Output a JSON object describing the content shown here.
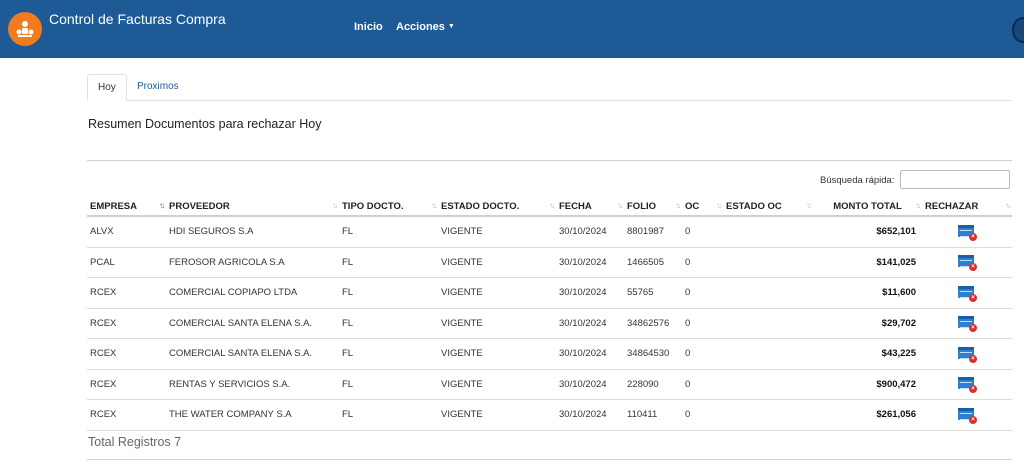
{
  "navbar": {
    "title": "Control de Facturas Compra",
    "links": {
      "inicio": "Inicio",
      "acciones": "Acciones"
    },
    "logo_icon": "people-network-icon",
    "color": "#1d5a96"
  },
  "tabs": {
    "hoy": "Hoy",
    "proximos": "Proximos"
  },
  "section_title": "Resumen Documentos para rechazar Hoy",
  "search": {
    "label": "Búsqueda rápida:",
    "value": ""
  },
  "table": {
    "columns": [
      "EMPRESA",
      "PROVEEDOR",
      "TIPO DOCTO.",
      "ESTADO DOCTO.",
      "FECHA",
      "FOLIO",
      "OC",
      "ESTADO OC",
      "MONTO TOTAL",
      "RECHAZAR"
    ],
    "sorted_column": "EMPRESA",
    "sort_direction": "ascending",
    "rows": [
      {
        "empresa": "ALVX",
        "proveedor": "HDI SEGUROS S.A",
        "tipo": "FL",
        "estado": "VIGENTE",
        "fecha": "30/10/2024",
        "folio": "8801987",
        "oc": "0",
        "estado_oc": "",
        "monto": "$652,101"
      },
      {
        "empresa": "PCAL",
        "proveedor": "FEROSOR AGRICOLA S.A",
        "tipo": "FL",
        "estado": "VIGENTE",
        "fecha": "30/10/2024",
        "folio": "1466505",
        "oc": "0",
        "estado_oc": "",
        "monto": "$141,025"
      },
      {
        "empresa": "RCEX",
        "proveedor": "COMERCIAL COPIAPO LTDA",
        "tipo": "FL",
        "estado": "VIGENTE",
        "fecha": "30/10/2024",
        "folio": "55765",
        "oc": "0",
        "estado_oc": "",
        "monto": "$11,600"
      },
      {
        "empresa": "RCEX",
        "proveedor": "COMERCIAL SANTA ELENA S.A.",
        "tipo": "FL",
        "estado": "VIGENTE",
        "fecha": "30/10/2024",
        "folio": "34862576",
        "oc": "0",
        "estado_oc": "",
        "monto": "$29,702"
      },
      {
        "empresa": "RCEX",
        "proveedor": "COMERCIAL SANTA ELENA S.A.",
        "tipo": "FL",
        "estado": "VIGENTE",
        "fecha": "30/10/2024",
        "folio": "34864530",
        "oc": "0",
        "estado_oc": "",
        "monto": "$43,225"
      },
      {
        "empresa": "RCEX",
        "proveedor": "RENTAS Y SERVICIOS S.A.",
        "tipo": "FL",
        "estado": "VIGENTE",
        "fecha": "30/10/2024",
        "folio": "228090",
        "oc": "0",
        "estado_oc": "",
        "monto": "$900,472"
      },
      {
        "empresa": "RCEX",
        "proveedor": "THE WATER COMPANY S.A",
        "tipo": "FL",
        "estado": "VIGENTE",
        "fecha": "30/10/2024",
        "folio": "110411",
        "oc": "0",
        "estado_oc": "",
        "monto": "$261,056"
      }
    ]
  },
  "total": "Total Registros 7"
}
